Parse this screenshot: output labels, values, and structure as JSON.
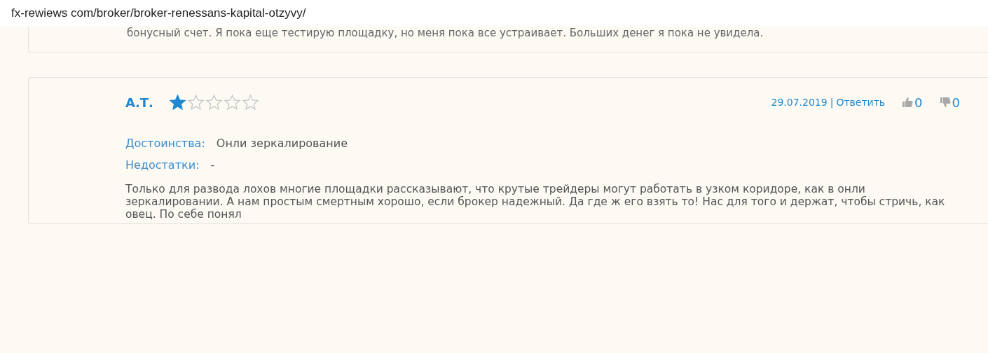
{
  "address_bar": {
    "url": "fx-rewiews com/broker/broker-renessans-kapital-otzyvy/"
  },
  "previous_review": {
    "text": "бонусный счет. Я пока еще тестирую площадку, но меня пока все устраивает. Больших денег я пока не увидела."
  },
  "review": {
    "author": "А.Т.",
    "stars": 1,
    "date": "29.07.2019",
    "separator": "|",
    "reply": "Ответить",
    "likes": "0",
    "dislikes": "0",
    "pros_label": "Достоинства:",
    "pros": "Онли зеркалирование",
    "cons_label": "Недостатки:",
    "cons": "-",
    "text": "Только для развода лохов многие площадки рассказывают, что крутые трейдеры могут работать в узком коридоре, как в онли зеркалировании. А нам простым смертным хорошо, если брокер надежный. Да где ж его взять то! Нас для того и держат, чтобы стричь, как овец. По себе понял"
  }
}
